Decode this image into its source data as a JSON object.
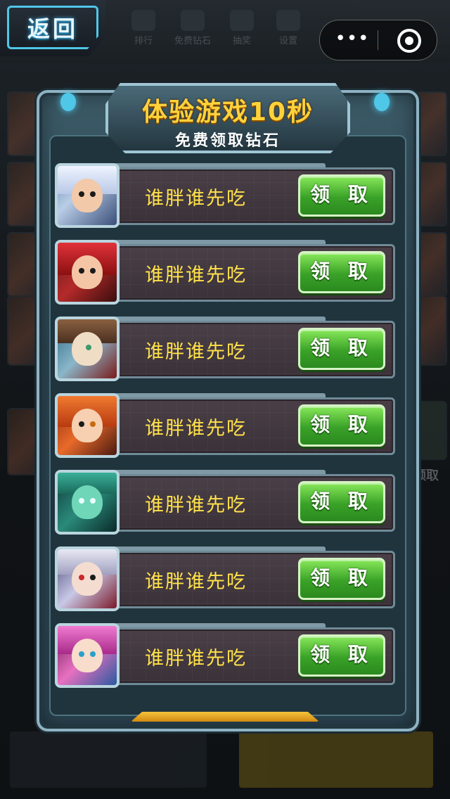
{
  "header": {
    "back_label": "返回",
    "nav": [
      "排行",
      "免费钻石",
      "抽奖",
      "设置"
    ],
    "capsule_more": "•••"
  },
  "background": {
    "right_text": "领取"
  },
  "dialog": {
    "title": "体验游戏10秒",
    "subtitle": "免费领取钻石",
    "items": [
      {
        "name": "谁胖谁先吃",
        "button": "领 取",
        "avatar": "white-haired-elf-hero"
      },
      {
        "name": "谁胖谁先吃",
        "button": "领 取",
        "avatar": "red-haired-warrior-hero"
      },
      {
        "name": "谁胖谁先吃",
        "button": "领 取",
        "avatar": "goggles-pilot-hero"
      },
      {
        "name": "谁胖谁先吃",
        "button": "领 取",
        "avatar": "fox-eared-girl-hero"
      },
      {
        "name": "谁胖谁先吃",
        "button": "领 取",
        "avatar": "green-goblin-hero"
      },
      {
        "name": "谁胖谁先吃",
        "button": "领 取",
        "avatar": "clown-masked-hero"
      },
      {
        "name": "谁胖谁先吃",
        "button": "领 取",
        "avatar": "pink-haired-girl-hero"
      }
    ]
  },
  "colors": {
    "title_gold": "#ffd23a",
    "name_yellow": "#ffe14a",
    "button_green": "#3aa228",
    "accent_cyan": "#4fc7e8"
  }
}
